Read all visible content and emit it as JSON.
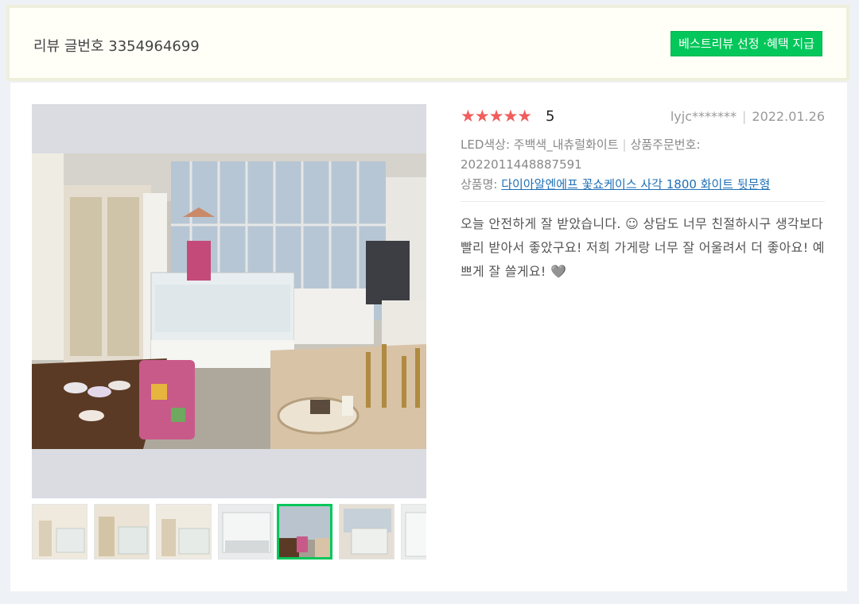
{
  "header": {
    "review_no": "리뷰 글번호 3354964699",
    "best_badge": "베스트리뷰 선정 ·혜택 지급"
  },
  "review": {
    "stars": "★★★★★",
    "score": "5",
    "user": "lyjc*******",
    "date": "2022.01.26",
    "option": "LED색상: 주백색_내츄럴화이트",
    "order_label": "상품주문번호:",
    "order_no": "2022011448887591",
    "product_label": "상품명:",
    "product_name": "다이아알엔에프 꽃쇼케이스 사각 1800 화이트 뒷문형",
    "text": "오늘 안전하게 잘 받았습니다. ☺ 상담도 너무 친절하시구 생각보다 빨리 받아서 좋았구요! 저희 가게랑 너무 잘 어울려서 더 좋아요! 예쁘게 잘 쓸게요! 🩶"
  },
  "colors": {
    "accent": "#03c75a",
    "star": "#f15d5d",
    "link": "#1f6fb5"
  },
  "thumbnails": {
    "count": 7,
    "selected_index": 4
  }
}
